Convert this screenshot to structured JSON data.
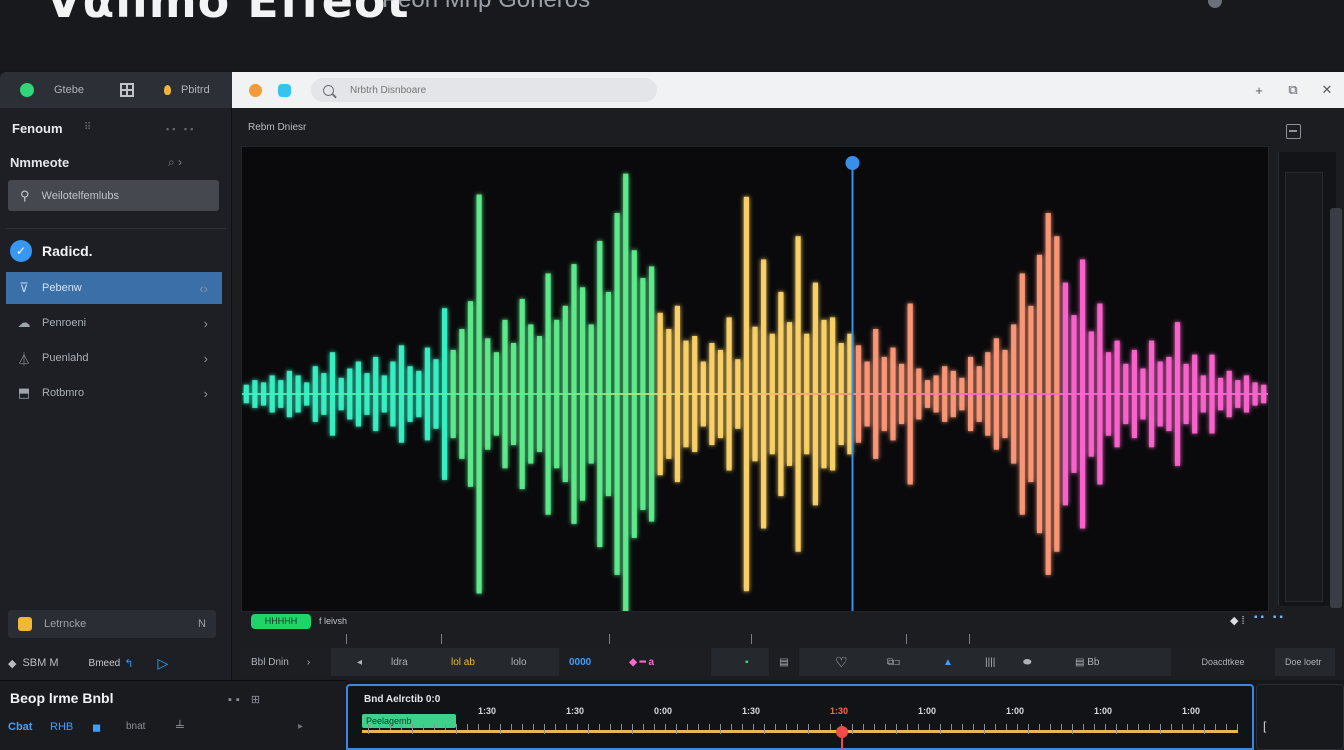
{
  "page": {
    "title": "Vαllmo Effeot",
    "subtitle": "Peon Mnp Goneros"
  },
  "toolbar": {
    "app_label": "Gtebe",
    "menu_label": "Pbitrd"
  },
  "browser": {
    "search_placeholder": "Nrbtrh Disnboare",
    "add": "+",
    "restore": "⧉",
    "close": "✕"
  },
  "sidebar": {
    "header": "Fenoum",
    "header_dots": "⠿",
    "header_icons": "▪▪ ▪▪",
    "section_title": "Nmmeote",
    "section_icons": "⌕  ›",
    "search_label": "Weilotelfemlubs",
    "group_label": "Radicd.",
    "items": [
      {
        "label": "Pebenw",
        "icon": "⊽",
        "active": true
      },
      {
        "label": "Penroeni",
        "icon": "☁",
        "active": false
      },
      {
        "label": "Puenlahd",
        "icon": "⏃",
        "active": false
      },
      {
        "label": "Rotbmro",
        "icon": "⬒",
        "active": false
      }
    ],
    "footer_label": "Letrncke",
    "footer_corner": "N",
    "bottom_label": "SBM M",
    "bottom_label2": "Bmeed",
    "bottom_icon": "↰",
    "bottom_play": "▷"
  },
  "editor": {
    "label": "Rebm Dniesr",
    "mini_chip": "HHHHH",
    "mini_label": "f leivsh",
    "mini_right": "▪▪ ▪▪",
    "mini_right_icon": "◆ ⁞",
    "controls": {
      "left_label": "Bbl Dnin",
      "left_chevron": "›",
      "prev": "◂",
      "c1": "ldra",
      "c2": "lol ab",
      "c3": "lolo",
      "c4": "0000",
      "c5": "◆ ━ a",
      "c6": "▪",
      "c7": "▤",
      "c8": "♡",
      "c9": "⧉⊐",
      "c10": "▲",
      "c11": "||||",
      "c12": "⬬",
      "c13": "▤ Bb",
      "c14": "Doacdtkee",
      "c15": "Doe loetr"
    }
  },
  "timeline": {
    "title": "Beop lrme Bnbl",
    "icons": "▪▪  ⊞",
    "row_a": "Cbat",
    "row_b": "RHB",
    "row_c": "◼",
    "row_d": "bnat",
    "row_e": "╧",
    "row_f": "▸",
    "clip_label": "Bnd  Aelrctib  0:0",
    "track_chip": "Peelagemb",
    "times": [
      "1:30",
      "1:30",
      "0:00",
      "1:30",
      "1:30",
      "1:00",
      "1:00",
      "1:00",
      "1:00",
      "1:00"
    ],
    "hot_index": 4,
    "bracket": "["
  },
  "colors": {
    "accent": "#3b6fa8",
    "playhead": "#3a8ee8",
    "timeline_marker": "#f04a4a",
    "wave_green": "#39f5c8",
    "wave_yellow": "#ffd66a",
    "wave_pink": "#ff66d0"
  },
  "chart_data": {
    "type": "bar",
    "title": "",
    "xlabel": "",
    "ylabel": "",
    "ylim": [
      0,
      1
    ],
    "playhead_position_fraction": 0.595,
    "values": [
      0.04,
      0.06,
      0.05,
      0.08,
      0.06,
      0.1,
      0.08,
      0.05,
      0.12,
      0.09,
      0.18,
      0.07,
      0.11,
      0.14,
      0.09,
      0.16,
      0.08,
      0.14,
      0.21,
      0.12,
      0.1,
      0.2,
      0.15,
      0.37,
      0.19,
      0.28,
      0.4,
      0.86,
      0.24,
      0.18,
      0.32,
      0.22,
      0.41,
      0.3,
      0.25,
      0.52,
      0.32,
      0.38,
      0.56,
      0.46,
      0.3,
      0.66,
      0.44,
      0.78,
      0.95,
      0.62,
      0.5,
      0.55,
      0.35,
      0.28,
      0.38,
      0.23,
      0.25,
      0.14,
      0.22,
      0.19,
      0.33,
      0.15,
      0.85,
      0.29,
      0.58,
      0.26,
      0.44,
      0.31,
      0.68,
      0.26,
      0.48,
      0.32,
      0.33,
      0.22,
      0.26,
      0.21,
      0.14,
      0.28,
      0.16,
      0.2,
      0.13,
      0.39,
      0.11,
      0.06,
      0.08,
      0.12,
      0.1,
      0.07,
      0.16,
      0.12,
      0.18,
      0.24,
      0.19,
      0.3,
      0.52,
      0.38,
      0.6,
      0.78,
      0.68,
      0.48,
      0.34,
      0.58,
      0.27,
      0.39,
      0.18,
      0.23,
      0.13,
      0.19,
      0.11,
      0.23,
      0.14,
      0.16,
      0.31,
      0.13,
      0.17,
      0.08,
      0.17,
      0.07,
      0.1,
      0.06,
      0.08,
      0.05,
      0.04
    ],
    "segment_colors": [
      "#39f5c8",
      "#5ff08e",
      "#ffd66a",
      "#ff9a7a",
      "#ff66d0"
    ]
  }
}
